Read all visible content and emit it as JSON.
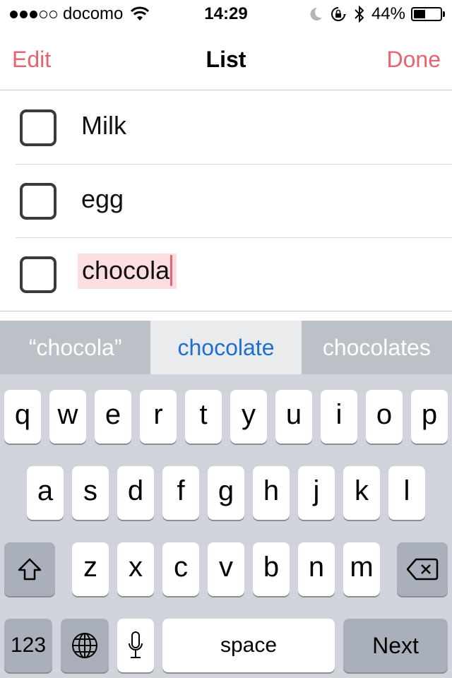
{
  "status_bar": {
    "signal_filled": 3,
    "signal_total": 5,
    "carrier": "docomo",
    "time": "14:29",
    "battery_percent": "44%",
    "battery_level": 0.44,
    "icons": [
      "wifi-icon",
      "moon-icon",
      "rotation-lock-icon",
      "bluetooth-icon",
      "battery-icon"
    ]
  },
  "nav": {
    "edit_label": "Edit",
    "title": "List",
    "done_label": "Done",
    "accent_color": "#e8636f"
  },
  "list": {
    "items": [
      {
        "text": "Milk",
        "checked": false
      },
      {
        "text": "egg",
        "checked": false
      },
      {
        "text": "chocola",
        "checked": false,
        "editing": true
      }
    ]
  },
  "keyboard": {
    "suggestions": [
      "“chocola”",
      "chocolate",
      "chocolates"
    ],
    "rows": [
      [
        "q",
        "w",
        "e",
        "r",
        "t",
        "y",
        "u",
        "i",
        "o",
        "p"
      ],
      [
        "a",
        "s",
        "d",
        "f",
        "g",
        "h",
        "j",
        "k",
        "l"
      ],
      [
        "z",
        "x",
        "c",
        "v",
        "b",
        "n",
        "m"
      ]
    ],
    "numbers_label": "123",
    "space_label": "space",
    "return_label": "Next"
  }
}
